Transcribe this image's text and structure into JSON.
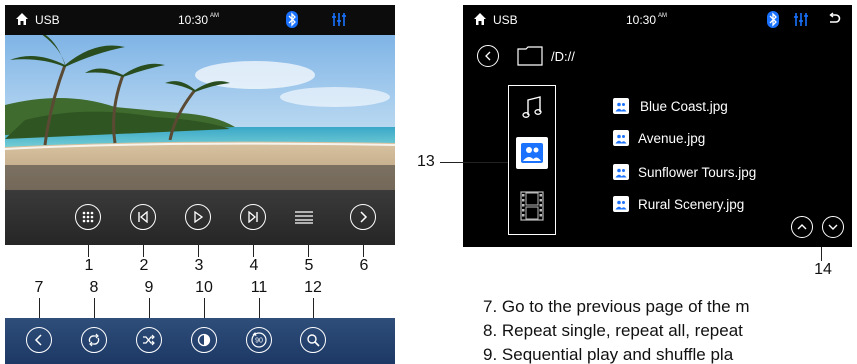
{
  "colors": {
    "accent_blue": "#1a72ff",
    "strip": "#234474"
  },
  "left_screen": {
    "status": {
      "source": "USB",
      "time": "10:30",
      "ampm": "AM"
    },
    "controls": [
      {
        "name": "grid-menu",
        "icon": "grid-dots-icon"
      },
      {
        "name": "previous-track",
        "icon": "skip-previous-icon"
      },
      {
        "name": "play",
        "icon": "play-icon"
      },
      {
        "name": "next-track",
        "icon": "skip-next-icon"
      },
      {
        "name": "list",
        "icon": "list-icon"
      },
      {
        "name": "next-page",
        "icon": "chevron-right-icon"
      }
    ]
  },
  "top_numbers": [
    "1",
    "2",
    "3",
    "4",
    "5",
    "6"
  ],
  "bottom_numbers": [
    "7",
    "8",
    "9",
    "10",
    "11",
    "12"
  ],
  "bottom_strip": {
    "buttons": [
      {
        "name": "previous-page",
        "icon": "chevron-left-icon"
      },
      {
        "name": "repeat",
        "icon": "repeat-icon"
      },
      {
        "name": "shuffle",
        "icon": "shuffle-icon"
      },
      {
        "name": "contrast",
        "icon": "contrast-icon"
      },
      {
        "name": "rotate",
        "icon": "rotate-90-icon",
        "label": "90"
      },
      {
        "name": "zoom",
        "icon": "zoom-icon"
      }
    ]
  },
  "right_screen": {
    "status": {
      "source": "USB",
      "time": "10:30",
      "ampm": "AM"
    },
    "path": "/D://",
    "filters": [
      "music-note-icon",
      "photo-icon",
      "film-icon"
    ],
    "files": [
      "Blue Coast.jpg",
      "Avenue.jpg",
      "Sunflower Tours.jpg",
      "Rural Scenery.jpg"
    ]
  },
  "callouts": {
    "panel": "13",
    "scroll": "14"
  },
  "descriptions": [
    "7. Go to the previous page of the m",
    "8. Repeat single, repeat all, repeat",
    "9. Sequential play and shuffle pla"
  ]
}
